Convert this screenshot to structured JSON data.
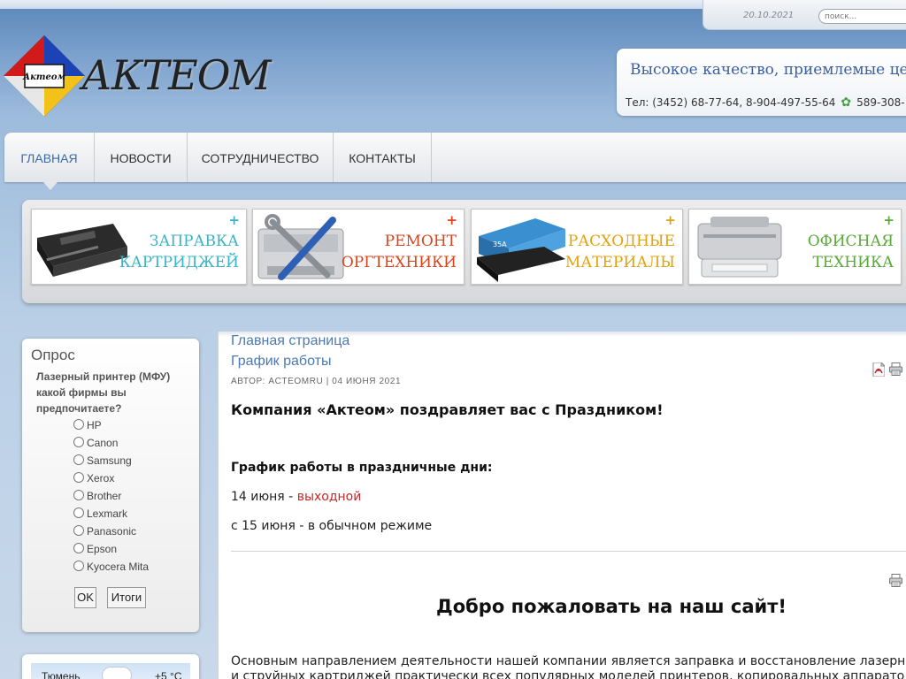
{
  "header": {
    "date": "20.10.2021",
    "search_placeholder": "поиск...",
    "logo_badge": "Актеом",
    "logo_text": "АКТЕОМ",
    "slogan": "Высокое качество, приемлемые цены",
    "phones": "Тел: (3452) 68-77-64, 8-904-497-55-64",
    "icq": "589-308-"
  },
  "nav": {
    "items": [
      {
        "label": "ГЛАВНАЯ"
      },
      {
        "label": "НОВОСТИ"
      },
      {
        "label": "СОТРУДНИЧЕСТВО"
      },
      {
        "label": "КОНТАКТЫ"
      }
    ]
  },
  "banners": [
    {
      "line1": "ЗАПРАВКА",
      "line2": "КАРТРИДЖЕЙ",
      "plus": "+",
      "color": "#3ab3c4"
    },
    {
      "line1": "РЕМОНТ",
      "line2": "ОРГТЕХНИКИ",
      "plus": "+",
      "color": "#d9441c"
    },
    {
      "line1": "РАСХОДНЫЕ",
      "line2": "МАТЕРИАЛЫ",
      "plus": "+",
      "color": "#e0a30c"
    },
    {
      "line1": "ОФИСНАЯ",
      "line2": "ТЕХНИКА",
      "plus": "+",
      "color": "#5aa83a"
    }
  ],
  "poll": {
    "title": "Опрос",
    "question": "Лазерный принтер (МФУ) какой фирмы вы предпочитаете?",
    "options": [
      "HP",
      "Canon",
      "Samsung",
      "Xerox",
      "Brother",
      "Lexmark",
      "Panasonic",
      "Epson",
      "Kyocera Mita"
    ],
    "ok_label": "OK",
    "results_label": "Итоги"
  },
  "weather": {
    "city": "Тюмень",
    "temp": "+5 °C"
  },
  "content": {
    "breadcrumb_home": "Главная страница",
    "breadcrumb_current": "График работы",
    "meta": "АВТОР: ACTEOMRU | 04 ИЮНЯ 2021",
    "headline": "Компания «Актеом» поздравляет вас с Праздником!",
    "schedule_title": "График работы в праздничные дни:",
    "line1_prefix": "14 июня - ",
    "line1_red": "выходной",
    "line2": "с 15 июня - в обычном режиме",
    "welcome": "Добро пожаловать на наш сайт!",
    "paragraph_1": "Основным направлением деятельности нашей компании является заправка и восстановление лазерны",
    "paragraph_2": "и струйных картриджей практически всех популярных моделей принтеров, копировальных аппарато"
  }
}
